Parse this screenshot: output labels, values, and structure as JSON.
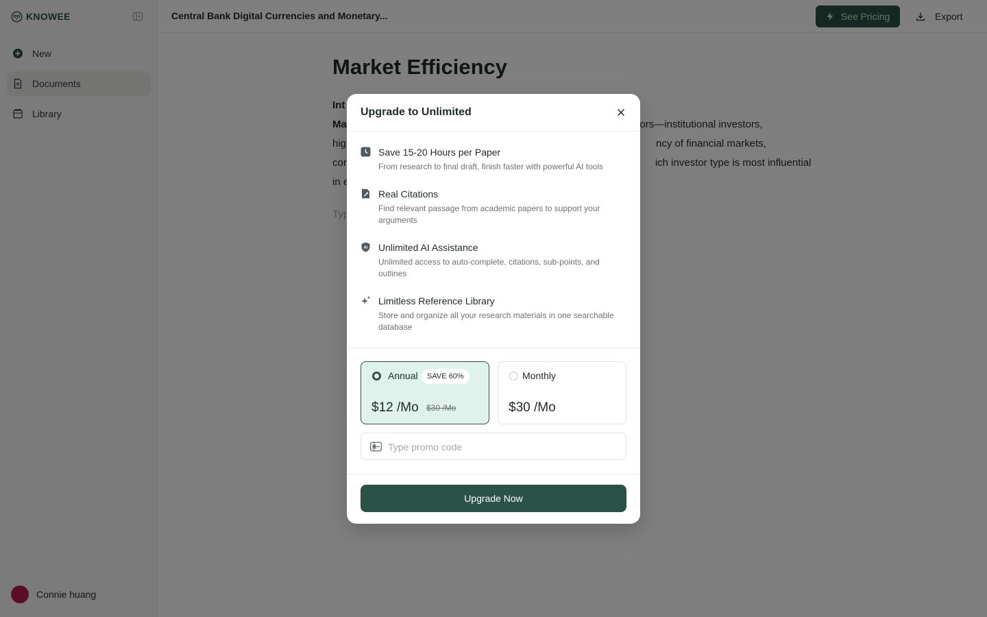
{
  "sidebar": {
    "brand": "KNOWEE",
    "items": [
      {
        "label": "New"
      },
      {
        "label": "Documents"
      },
      {
        "label": "Library"
      }
    ],
    "user_name": "Connie huang"
  },
  "topbar": {
    "doc_title": "Central Bank Digital Currencies and Monetary...",
    "pricing_label": "See Pricing",
    "export_label": "Export"
  },
  "document": {
    "heading": "Market Efficiency",
    "line1": "Int",
    "line2_bold": "Ma",
    "line2_rest": "f investors—institutional investors,",
    "line3_start": "hig",
    "line3_end": "ncy of financial markets,",
    "line4_start": "cor",
    "line4_end": "ich investor type is most influential",
    "line5": "in e",
    "placeholder": "Typ"
  },
  "modal": {
    "title": "Upgrade to Unlimited",
    "features": [
      {
        "title": "Save 15-20 Hours per Paper",
        "desc": "From research to final draft, finish faster with powerful AI tools"
      },
      {
        "title": "Real Citations",
        "desc": "Find relevant passage from academic papers to support your arguments"
      },
      {
        "title": "Unlimited AI Assistance",
        "desc": "Unlimited access to auto-complete, citations, sub-points, and outlines"
      },
      {
        "title": "Limitless Reference Library",
        "desc": "Store and organize all your research materials in one searchable database"
      }
    ],
    "plans": {
      "annual": {
        "name": "Annual",
        "badge": "SAVE 60%",
        "price": "$12 /Mo",
        "old_price": "$30 /Mo"
      },
      "monthly": {
        "name": "Monthly",
        "price": "$30 /Mo"
      }
    },
    "promo_placeholder": "Type promo code",
    "upgrade_label": "Upgrade Now"
  },
  "colors": {
    "primary": "#2a5248",
    "pricing_text": "#c9e9c6",
    "selected_plan_bg": "#e0f2ec",
    "avatar": "#b51a4d"
  },
  "icons": {
    "brand": "owl-logo-icon",
    "collapse": "sidebar-toggle-icon",
    "new": "plus-circle-icon",
    "documents": "document-icon",
    "library": "library-icon",
    "pricing": "lightning-icon",
    "export": "download-icon",
    "close": "close-icon",
    "features": [
      "clock-icon",
      "citation-icon",
      "ai-shield-icon",
      "sparkle-icon"
    ],
    "promo": "ticket-icon"
  }
}
